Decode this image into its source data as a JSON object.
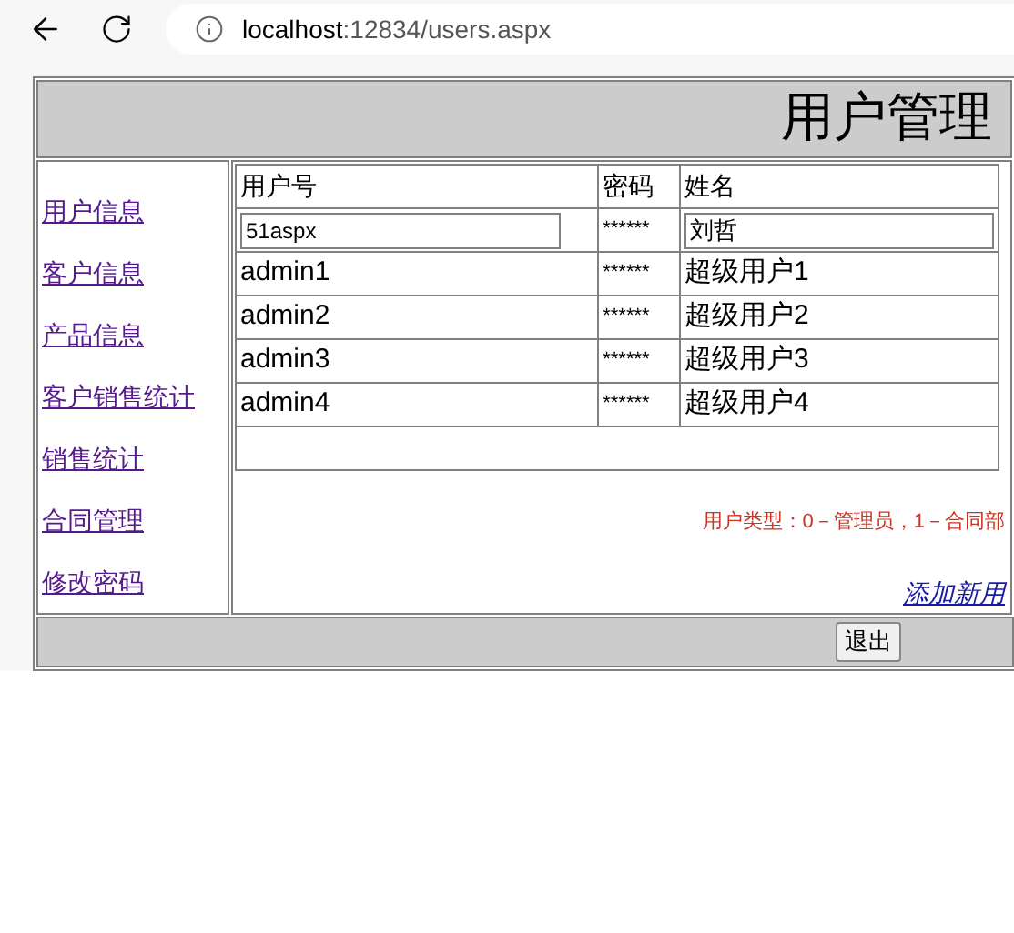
{
  "browser": {
    "address_host": "localhost",
    "address_path": ":12834/users.aspx"
  },
  "header": {
    "title": "用户管理"
  },
  "sidebar": {
    "items": [
      {
        "label": "用户信息"
      },
      {
        "label": "客户信息"
      },
      {
        "label": "产品信息"
      },
      {
        "label": "客户销售统计"
      },
      {
        "label": "销售统计"
      },
      {
        "label": "合同管理"
      },
      {
        "label": "修改密码"
      }
    ]
  },
  "table": {
    "columns": [
      "用户号",
      "密码",
      "姓名"
    ],
    "new_row": {
      "user_id": "51aspx",
      "password": "******",
      "name": "刘哲"
    },
    "rows": [
      {
        "user_id": "admin1",
        "password": "******",
        "name": "超级用户1"
      },
      {
        "user_id": "admin2",
        "password": "******",
        "name": "超级用户2"
      },
      {
        "user_id": "admin3",
        "password": "******",
        "name": "超级用户3"
      },
      {
        "user_id": "admin4",
        "password": "******",
        "name": "超级用户4"
      }
    ]
  },
  "note": "用户类型：0－管理员，1－合同部",
  "add_link": "添加新用",
  "footer": {
    "button": "退出"
  }
}
